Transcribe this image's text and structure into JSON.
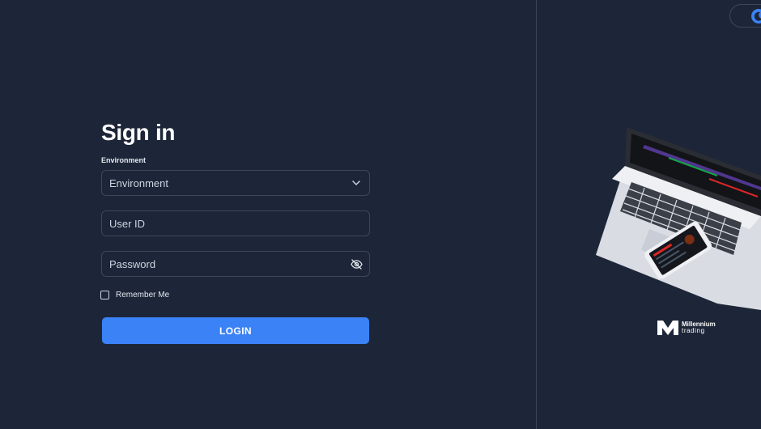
{
  "form": {
    "title": "Sign in",
    "environment_label": "Environment",
    "environment_value": "Environment",
    "user_id_placeholder": "User ID",
    "password_placeholder": "Password",
    "remember_label": "Remember Me",
    "login_label": "LOGIN"
  },
  "brand": {
    "name": "Millennium",
    "sub": "trading"
  },
  "icons": {
    "environment_dropdown": "chevron-down-icon",
    "password_toggle": "eye-off-icon",
    "theme_toggle": "moon-icon"
  },
  "colors": {
    "background": "#1d2638",
    "accent": "#3b82f6",
    "border": "#3b475a"
  }
}
